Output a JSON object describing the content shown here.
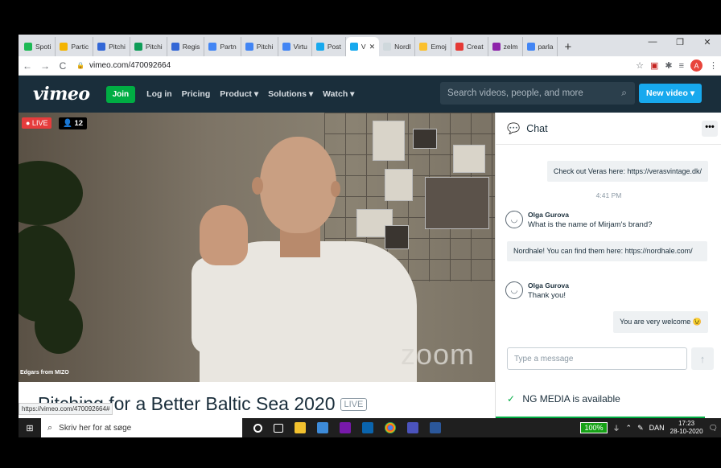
{
  "browser": {
    "tabs": [
      {
        "label": "Spoti",
        "color": "#1db954"
      },
      {
        "label": "Partic",
        "color": "#f4b400"
      },
      {
        "label": "Pitchi",
        "color": "#3367d6"
      },
      {
        "label": "Pitchi",
        "color": "#0f9d58"
      },
      {
        "label": "Regis",
        "color": "#3367d6"
      },
      {
        "label": "Partn",
        "color": "#4285f4"
      },
      {
        "label": "Pitchi",
        "color": "#4285f4"
      },
      {
        "label": "Virtu",
        "color": "#4285f4"
      },
      {
        "label": "Post",
        "color": "#17a9ee"
      },
      {
        "label": "V",
        "color": "#17a9ee",
        "active": true
      },
      {
        "label": "Nordl",
        "color": "#cfd8dc"
      },
      {
        "label": "Emoj",
        "color": "#fbc02d"
      },
      {
        "label": "Creat",
        "color": "#e53935"
      },
      {
        "label": "zelm",
        "color": "#8e24aa"
      },
      {
        "label": "parla",
        "color": "#4285f4"
      }
    ],
    "url": "vimeo.com/470092664",
    "avatar_letter": "A",
    "icons": {
      "back": "←",
      "forward": "→",
      "reload": "C",
      "star": "☆",
      "shield": "▣",
      "puzzle": "✱",
      "menu": "⋮",
      "playlist": "≡",
      "minimize": "—",
      "restore": "❐",
      "close": "✕",
      "new_tab": "+"
    }
  },
  "vimeo": {
    "logo": "vimeo",
    "join": "Join",
    "nav": [
      "Log in",
      "Pricing",
      "Product ▾",
      "Solutions ▾",
      "Watch ▾"
    ],
    "search_placeholder": "Search videos, people, and more",
    "new_video": "New video ▾"
  },
  "video": {
    "live_label": "● LIVE",
    "viewers": "12",
    "watermark": "zoom",
    "speaker": "Edgars from MIZO"
  },
  "chat": {
    "title": "Chat",
    "messages": {
      "m1": "Check out Veras here: https://verasvintage.dk/",
      "time": "4:41 PM",
      "m2_name": "Olga Gurova",
      "m2_text": "What is the name of Mirjam's brand?",
      "m3": "Nordhale! You can find them here: https://nordhale.com/",
      "m4_name": "Olga Gurova",
      "m4_text": "Thank you!",
      "m5": "You are very welcome 😉"
    },
    "input_placeholder": "Type a message"
  },
  "page": {
    "title": "Pitching for a Better Baltic Sea 2020",
    "live_tag": "LIVE",
    "status_url": "https://vimeo.com/470092664#",
    "ng_media": "NG MEDIA is available"
  },
  "taskbar": {
    "search_placeholder": "Skriv her for at søge",
    "battery": "100%",
    "language": "DAN",
    "time": "17:23",
    "date": "28-10-2020"
  }
}
